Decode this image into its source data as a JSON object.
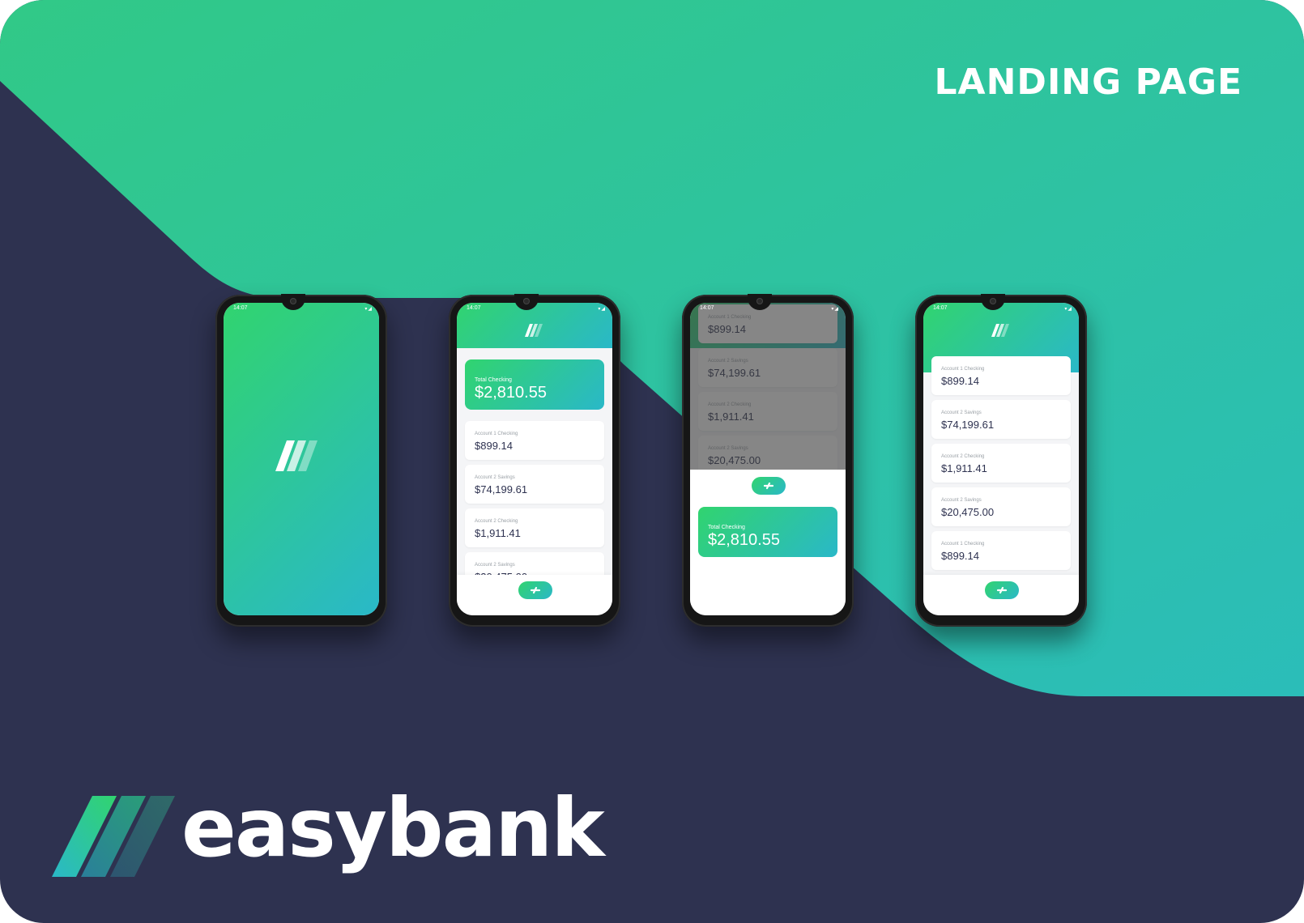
{
  "headline": "LANDING PAGE",
  "brand": {
    "name": "easybank",
    "logo_icon": "three-slash-stripes-logo"
  },
  "colors": {
    "navy": "#2e3250",
    "green": "#31d46f",
    "cyan": "#2ab8c8",
    "text_dark": "#2e3250",
    "text_muted": "#9aa0a6"
  },
  "status_time": "14:07",
  "status_icons": "wifi-icon signal-icon",
  "total": {
    "label": "Total Checking",
    "value": "$2,810.55"
  },
  "accounts": [
    {
      "label": "Account 1 Checking",
      "value": "$899.14"
    },
    {
      "label": "Account 2 Savings",
      "value": "$74,199.61"
    },
    {
      "label": "Account 2 Checking",
      "value": "$1,911.41"
    },
    {
      "label": "Account 2 Savings",
      "value": "$20,475.00"
    },
    {
      "label": "Account 1 Checking",
      "value": "$899.14"
    }
  ],
  "fab_icon": "transfer-icon",
  "phones": [
    {
      "screen": "splash"
    },
    {
      "screen": "dashboard"
    },
    {
      "screen": "dashboard-expanded-total"
    },
    {
      "screen": "accounts-scrolled"
    }
  ]
}
